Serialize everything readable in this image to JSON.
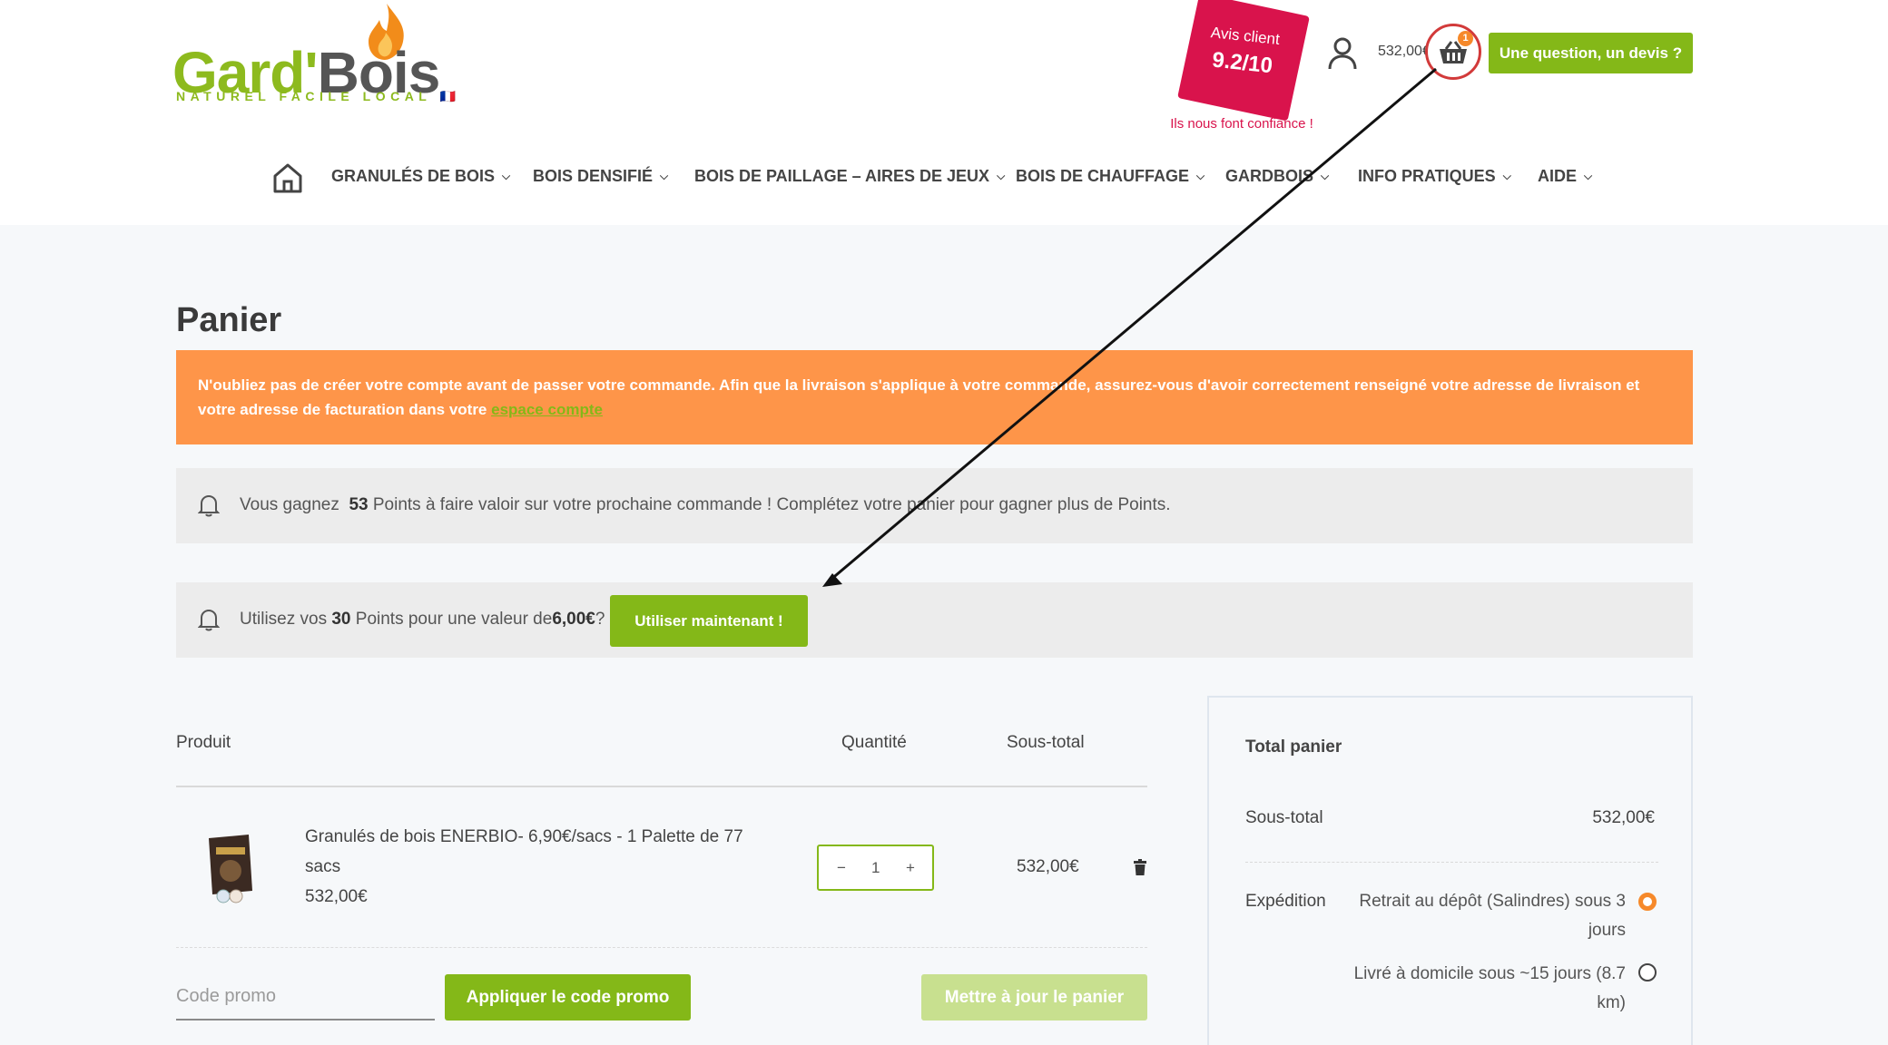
{
  "header": {
    "logo": {
      "name_part1": "Gard'",
      "name_part2": "Bois",
      "tagline": "NATUREL FACILE LOCAL",
      "flag": "🇫🇷"
    },
    "review_badge": {
      "title": "Avis client",
      "score": "9.2/10",
      "trust_line": "Ils nous font confiance !"
    },
    "account_icon": "user-icon",
    "cart_total": "532,00€",
    "cart_count": "1",
    "cart_icon": "basket-icon",
    "devis_button": "Une question, un devis ?"
  },
  "nav": {
    "home_icon": "home-icon",
    "items": [
      {
        "label": "GRANULÉS DE BOIS"
      },
      {
        "label": "BOIS DENSIFIÉ"
      },
      {
        "label": "BOIS DE PAILLAGE – AIRES DE JEUX"
      },
      {
        "label": "BOIS DE CHAUFFAGE"
      },
      {
        "label": "GARDBOIS"
      },
      {
        "label": "INFO PRATIQUES"
      },
      {
        "label": "AIDE"
      }
    ]
  },
  "page": {
    "title": "Panier"
  },
  "notice": {
    "text": "N'oubliez pas de créer votre compte avant de passer votre commande. Afin que la livraison s'applique à votre commande, assurez-vous d'avoir correctement renseigné votre adresse de livraison et votre adresse de facturation dans votre ",
    "link": "espace compte"
  },
  "points_earn": {
    "prefix": "Vous gagnez",
    "points": "53",
    "suffix": "Points à faire valoir sur votre prochaine commande ! Complétez votre panier pour gagner plus de Points."
  },
  "points_use": {
    "prefix": "Utilisez vos",
    "points": "30",
    "middle": "Points pour une valeur de",
    "value": "6,00€",
    "question": "?",
    "button": "Utiliser maintenant !"
  },
  "cart_table": {
    "headers": {
      "product": "Produit",
      "quantity": "Quantité",
      "subtotal": "Sous-total"
    },
    "rows": [
      {
        "name": "Granulés de bois ENERBIO- 6,90€/sacs - 1 Palette de 77 sacs",
        "price": "532,00€",
        "quantity": "1",
        "subtotal": "532,00€"
      }
    ],
    "qty_minus": "−",
    "qty_plus": "+"
  },
  "promo": {
    "placeholder": "Code promo",
    "apply_button": "Appliquer le code promo",
    "update_button": "Mettre à jour le panier"
  },
  "totals": {
    "title": "Total panier",
    "subtotal_label": "Sous-total",
    "subtotal_value": "532,00€",
    "shipping_label": "Expédition",
    "shipping_options": [
      {
        "label": "Retrait au dépôt (Salindres) sous 3 jours",
        "selected": true
      },
      {
        "label": "Livré à domicile sous ~15 jours (8.7 km)",
        "selected": false
      }
    ]
  },
  "colors": {
    "brand_green": "#84b818",
    "notice_orange": "#fe9549",
    "badge_red": "#d9134c",
    "radio_orange": "#f6892a"
  }
}
